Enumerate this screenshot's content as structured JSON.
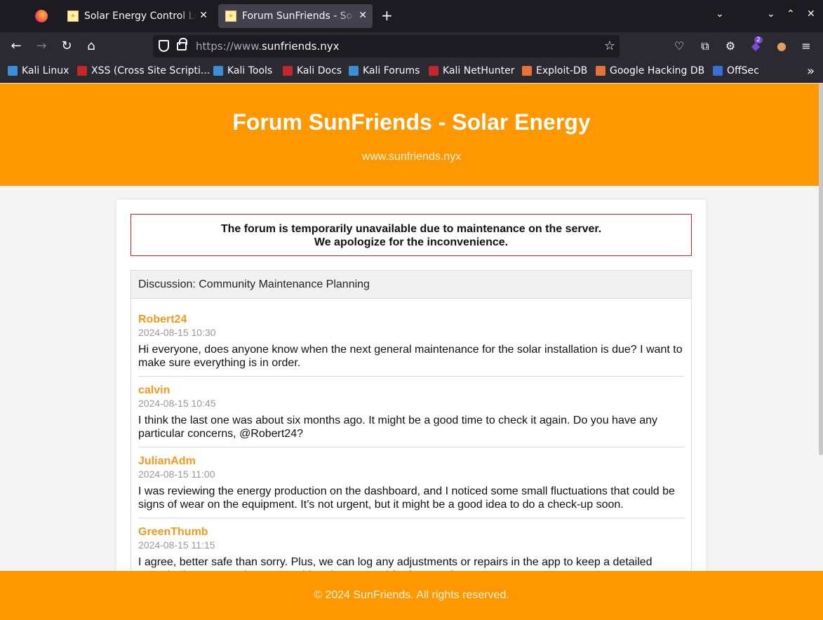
{
  "browser": {
    "tabs": [
      {
        "title": "Solar Energy Control Log",
        "active": false
      },
      {
        "title": "Forum SunFriends - Solar Energy",
        "active": true
      }
    ],
    "url_prefix": "https://www.",
    "url_domain": "sunfriends.nyx",
    "extension_badge": "2",
    "bookmarks": [
      {
        "label": "Kali Linux",
        "color": "#3b8fd6"
      },
      {
        "label": "XSS (Cross Site Scripti...",
        "color": "#c0282d"
      },
      {
        "label": "Kali Tools",
        "color": "#3b8fd6"
      },
      {
        "label": "Kali Docs",
        "color": "#c0282d"
      },
      {
        "label": "Kali Forums",
        "color": "#3b8fd6"
      },
      {
        "label": "Kali NetHunter",
        "color": "#c0282d"
      },
      {
        "label": "Exploit-DB",
        "color": "#e8733a"
      },
      {
        "label": "Google Hacking DB",
        "color": "#e8733a"
      },
      {
        "label": "OffSec",
        "color": "#3b6fd6"
      }
    ]
  },
  "site": {
    "title": "Forum SunFriends - Solar Energy",
    "domain": "www.sunfriends.nyx",
    "accent_color": "#ff9800",
    "alert_line1": "The forum is temporarily unavailable due to maintenance on the server.",
    "alert_line2": "We apologize for the inconvenience.",
    "discussion_title": "Discussion: Community Maintenance Planning",
    "posts": [
      {
        "author": "Robert24",
        "time": "2024-08-15 10:30",
        "message": "Hi everyone, does anyone know when the next general maintenance for the solar installation is due? I want to make sure everything is in order."
      },
      {
        "author": "calvin",
        "time": "2024-08-15 10:45",
        "message": "I think the last one was about six months ago. It might be a good time to check it again. Do you have any particular concerns, @Robert24?"
      },
      {
        "author": "JulianAdm",
        "time": "2024-08-15 11:00",
        "message": "I was reviewing the energy production on the dashboard, and I noticed some small fluctuations that could be signs of wear on the equipment. It’s not urgent, but it might be a good idea to do a check-up soon."
      },
      {
        "author": "GreenThumb",
        "time": "2024-08-15 11:15",
        "message": "I agree, better safe than sorry. Plus, we can log any adjustments or repairs in the app to keep a detailed record. That way, we have everything documented for future reference."
      }
    ],
    "footer": "© 2024 SunFriends. All rights reserved."
  }
}
